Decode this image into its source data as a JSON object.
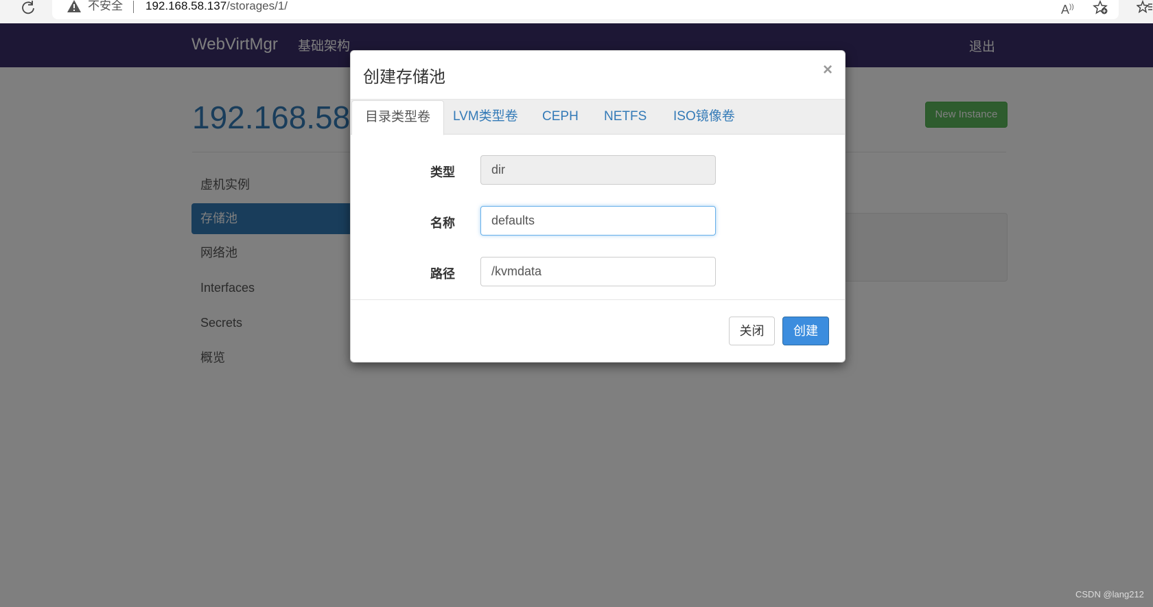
{
  "browser": {
    "insecure_label": "不安全",
    "url_host": "192.168.58.137",
    "url_path": "/storages/1/"
  },
  "navbar": {
    "brand": "WebVirtMgr",
    "infrastructure_link": "基础架构",
    "logout_link": "退出",
    "background_color": "#3a2f6b"
  },
  "page": {
    "heading": "192.168.58.",
    "new_instance_label": "New Instance",
    "side_nav": [
      {
        "label": "虚机实例",
        "active": false
      },
      {
        "label": "存储池",
        "active": true
      },
      {
        "label": "网络池",
        "active": false
      },
      {
        "label": "Interfaces",
        "active": false
      },
      {
        "label": "Secrets",
        "active": false
      },
      {
        "label": "概览",
        "active": false
      }
    ]
  },
  "modal": {
    "title": "创建存储池",
    "close_symbol": "×",
    "tabs": [
      {
        "label": "目录类型卷",
        "active": true
      },
      {
        "label": "LVM类型卷",
        "active": false
      },
      {
        "label": "CEPH",
        "active": false
      },
      {
        "label": "NETFS",
        "active": false
      },
      {
        "label": "ISO镜像卷",
        "active": false
      }
    ],
    "fields": {
      "type": {
        "label": "类型",
        "value": "dir"
      },
      "name": {
        "label": "名称",
        "value": "defaults"
      },
      "path": {
        "label": "路径",
        "value": "/kvmdata"
      }
    },
    "close_button": "关闭",
    "create_button": "创建"
  },
  "watermark": "CSDN @lang212",
  "colors": {
    "accent": "#337ab7",
    "success": "#5cb85c",
    "primary_button": "#3c8dde"
  }
}
